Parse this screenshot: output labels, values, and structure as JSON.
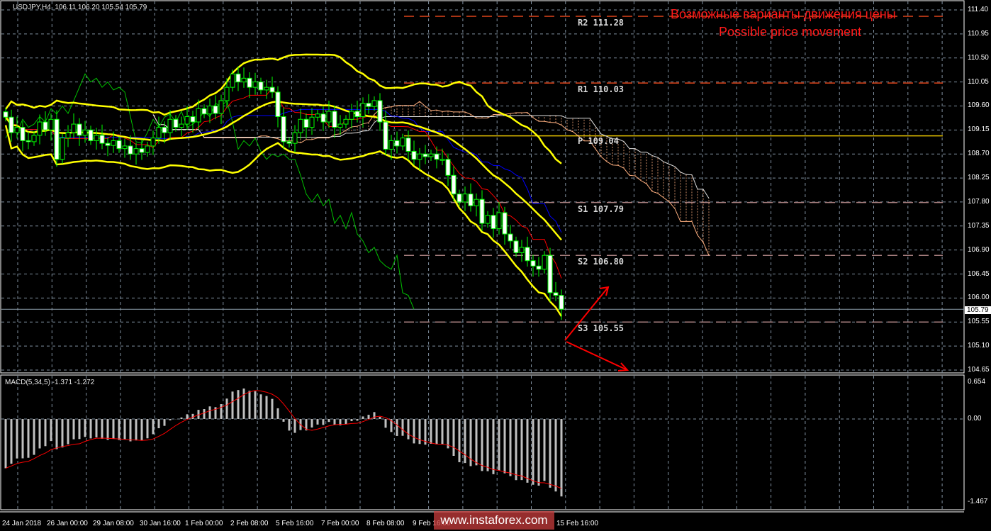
{
  "header": {
    "symbol": "USDJPY",
    "timeframe": "H4",
    "ohlc": "106.11 106.20 105.54 105.79"
  },
  "annotation": {
    "line1": "Возможные варианты движения цены",
    "line2": "Possible price movement"
  },
  "watermark": "www.instaforex.com",
  "colors": {
    "candle": "#00ff00",
    "bb": "#ffff00",
    "tenkan": "#ff0000",
    "kijun": "#0000ff",
    "chikou": "#00c000",
    "cloud": "#ffb080",
    "resistance": "#e0441a",
    "support": "#a88080",
    "pivot": "#e6c200",
    "arrow": "#ff0000",
    "macd_hist": "#c0c0c0",
    "macd_signal": "#ff0000"
  },
  "chart_data": {
    "type": "candlestick",
    "ylim": [
      104.65,
      111.4
    ],
    "price_ticks": [
      "111.40",
      "110.95",
      "110.50",
      "110.05",
      "109.60",
      "109.15",
      "108.70",
      "108.25",
      "107.80",
      "107.35",
      "106.90",
      "106.45",
      "106.00",
      "105.55",
      "105.10",
      "104.65"
    ],
    "current_price": "105.79",
    "time_labels": [
      "24 Jan 2018",
      "26 Jan 00:00",
      "29 Jan 08:00",
      "30 Jan 16:00",
      "1 Feb 00:00",
      "2 Feb 08:00",
      "5 Feb 16:00",
      "7 Feb 00:00",
      "8 Feb 08:00",
      "9 Feb 16:00",
      "15 Feb 16:00"
    ],
    "closes": [
      109.39,
      109.1,
      109.2,
      108.95,
      108.93,
      109.05,
      109.3,
      109.15,
      109.35,
      108.6,
      109.0,
      109.1,
      109.26,
      109.05,
      109.15,
      108.95,
      109.05,
      108.9,
      108.86,
      108.95,
      108.8,
      108.85,
      108.7,
      108.8,
      108.73,
      108.85,
      109.0,
      109.2,
      109.1,
      109.35,
      109.2,
      109.26,
      109.4,
      109.3,
      109.55,
      109.45,
      109.6,
      109.46,
      109.7,
      109.95,
      110.2,
      110.05,
      110.12,
      109.95,
      110.05,
      109.9,
      109.95,
      109.86,
      109.4,
      108.93,
      108.9,
      109.1,
      109.35,
      109.2,
      109.39,
      109.45,
      109.3,
      109.5,
      109.2,
      109.26,
      109.35,
      109.5,
      109.4,
      109.65,
      109.59,
      109.7,
      109.3,
      108.79,
      108.95,
      108.85,
      109.0,
      108.75,
      108.6,
      108.7,
      108.65,
      108.7,
      108.6,
      108.6,
      108.3,
      107.95,
      107.8,
      107.95,
      107.73,
      107.85,
      107.4,
      107.55,
      107.3,
      107.6,
      107.2,
      107.07,
      106.85,
      106.95,
      106.7,
      106.6,
      106.54,
      106.8,
      106.1,
      106.05,
      105.79
    ],
    "levels": [
      {
        "name": "R2",
        "value": 111.28,
        "label": "R2 111.28",
        "kind": "resistance"
      },
      {
        "name": "R1",
        "value": 110.03,
        "label": "R1 110.03",
        "kind": "resistance"
      },
      {
        "name": "P",
        "value": 109.04,
        "label": "P 109.04",
        "kind": "pivot"
      },
      {
        "name": "S1",
        "value": 107.79,
        "label": "S1 107.79",
        "kind": "support"
      },
      {
        "name": "S2",
        "value": 106.8,
        "label": "S2 106.80",
        "kind": "support"
      },
      {
        "name": "S3",
        "value": 105.55,
        "label": "S3 105.55",
        "kind": "support"
      }
    ],
    "macd": {
      "label": "MACD(5,34,5) -1.371 -1.272",
      "ylim": [
        -1.467,
        0.654
      ],
      "ticks": [
        "0.654",
        "0.00",
        "-1.467"
      ]
    }
  }
}
